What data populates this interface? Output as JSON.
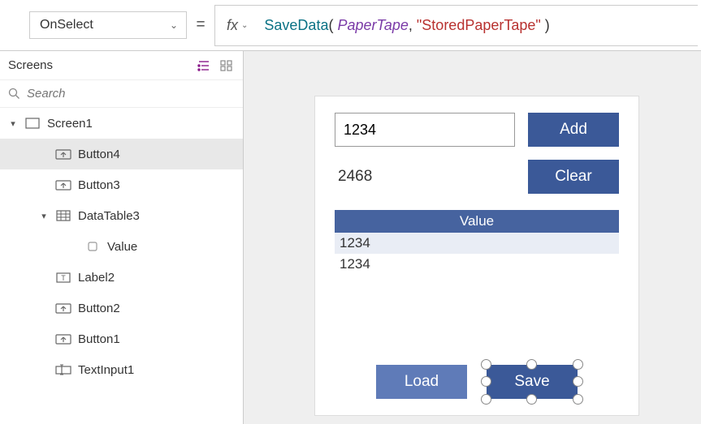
{
  "topbar": {
    "property": "OnSelect",
    "fx_label": "fx",
    "formula_tokens": [
      {
        "t": "func",
        "v": "SaveData"
      },
      {
        "t": "punc",
        "v": "( "
      },
      {
        "t": "ident",
        "v": "PaperTape"
      },
      {
        "t": "punc",
        "v": ", "
      },
      {
        "t": "string",
        "v": "\"StoredPaperTape\""
      },
      {
        "t": "punc",
        "v": " )"
      }
    ]
  },
  "leftpane": {
    "title": "Screens",
    "search_placeholder": "Search",
    "tree": [
      {
        "level": 0,
        "caret": "▾",
        "icon": "screen-icon",
        "label": "Screen1",
        "selected": false
      },
      {
        "level": 1,
        "caret": "",
        "icon": "button-icon",
        "label": "Button4",
        "selected": true
      },
      {
        "level": 1,
        "caret": "",
        "icon": "button-icon",
        "label": "Button3",
        "selected": false
      },
      {
        "level": 1,
        "caret": "▾",
        "icon": "datatable-icon",
        "label": "DataTable3",
        "selected": false
      },
      {
        "level": 2,
        "caret": "",
        "icon": "column-icon",
        "label": "Value",
        "selected": false
      },
      {
        "level": 1,
        "caret": "",
        "icon": "label-icon",
        "label": "Label2",
        "selected": false
      },
      {
        "level": 1,
        "caret": "",
        "icon": "button-icon",
        "label": "Button2",
        "selected": false
      },
      {
        "level": 1,
        "caret": "",
        "icon": "button-icon",
        "label": "Button1",
        "selected": false
      },
      {
        "level": 1,
        "caret": "",
        "icon": "textinput-icon",
        "label": "TextInput1",
        "selected": false
      }
    ]
  },
  "app": {
    "text_input_value": "1234",
    "add_label": "Add",
    "result_label": "2468",
    "clear_label": "Clear",
    "datatable": {
      "header": "Value",
      "rows": [
        "1234",
        "1234"
      ],
      "selected_row": 0
    },
    "load_label": "Load",
    "save_label": "Save"
  }
}
